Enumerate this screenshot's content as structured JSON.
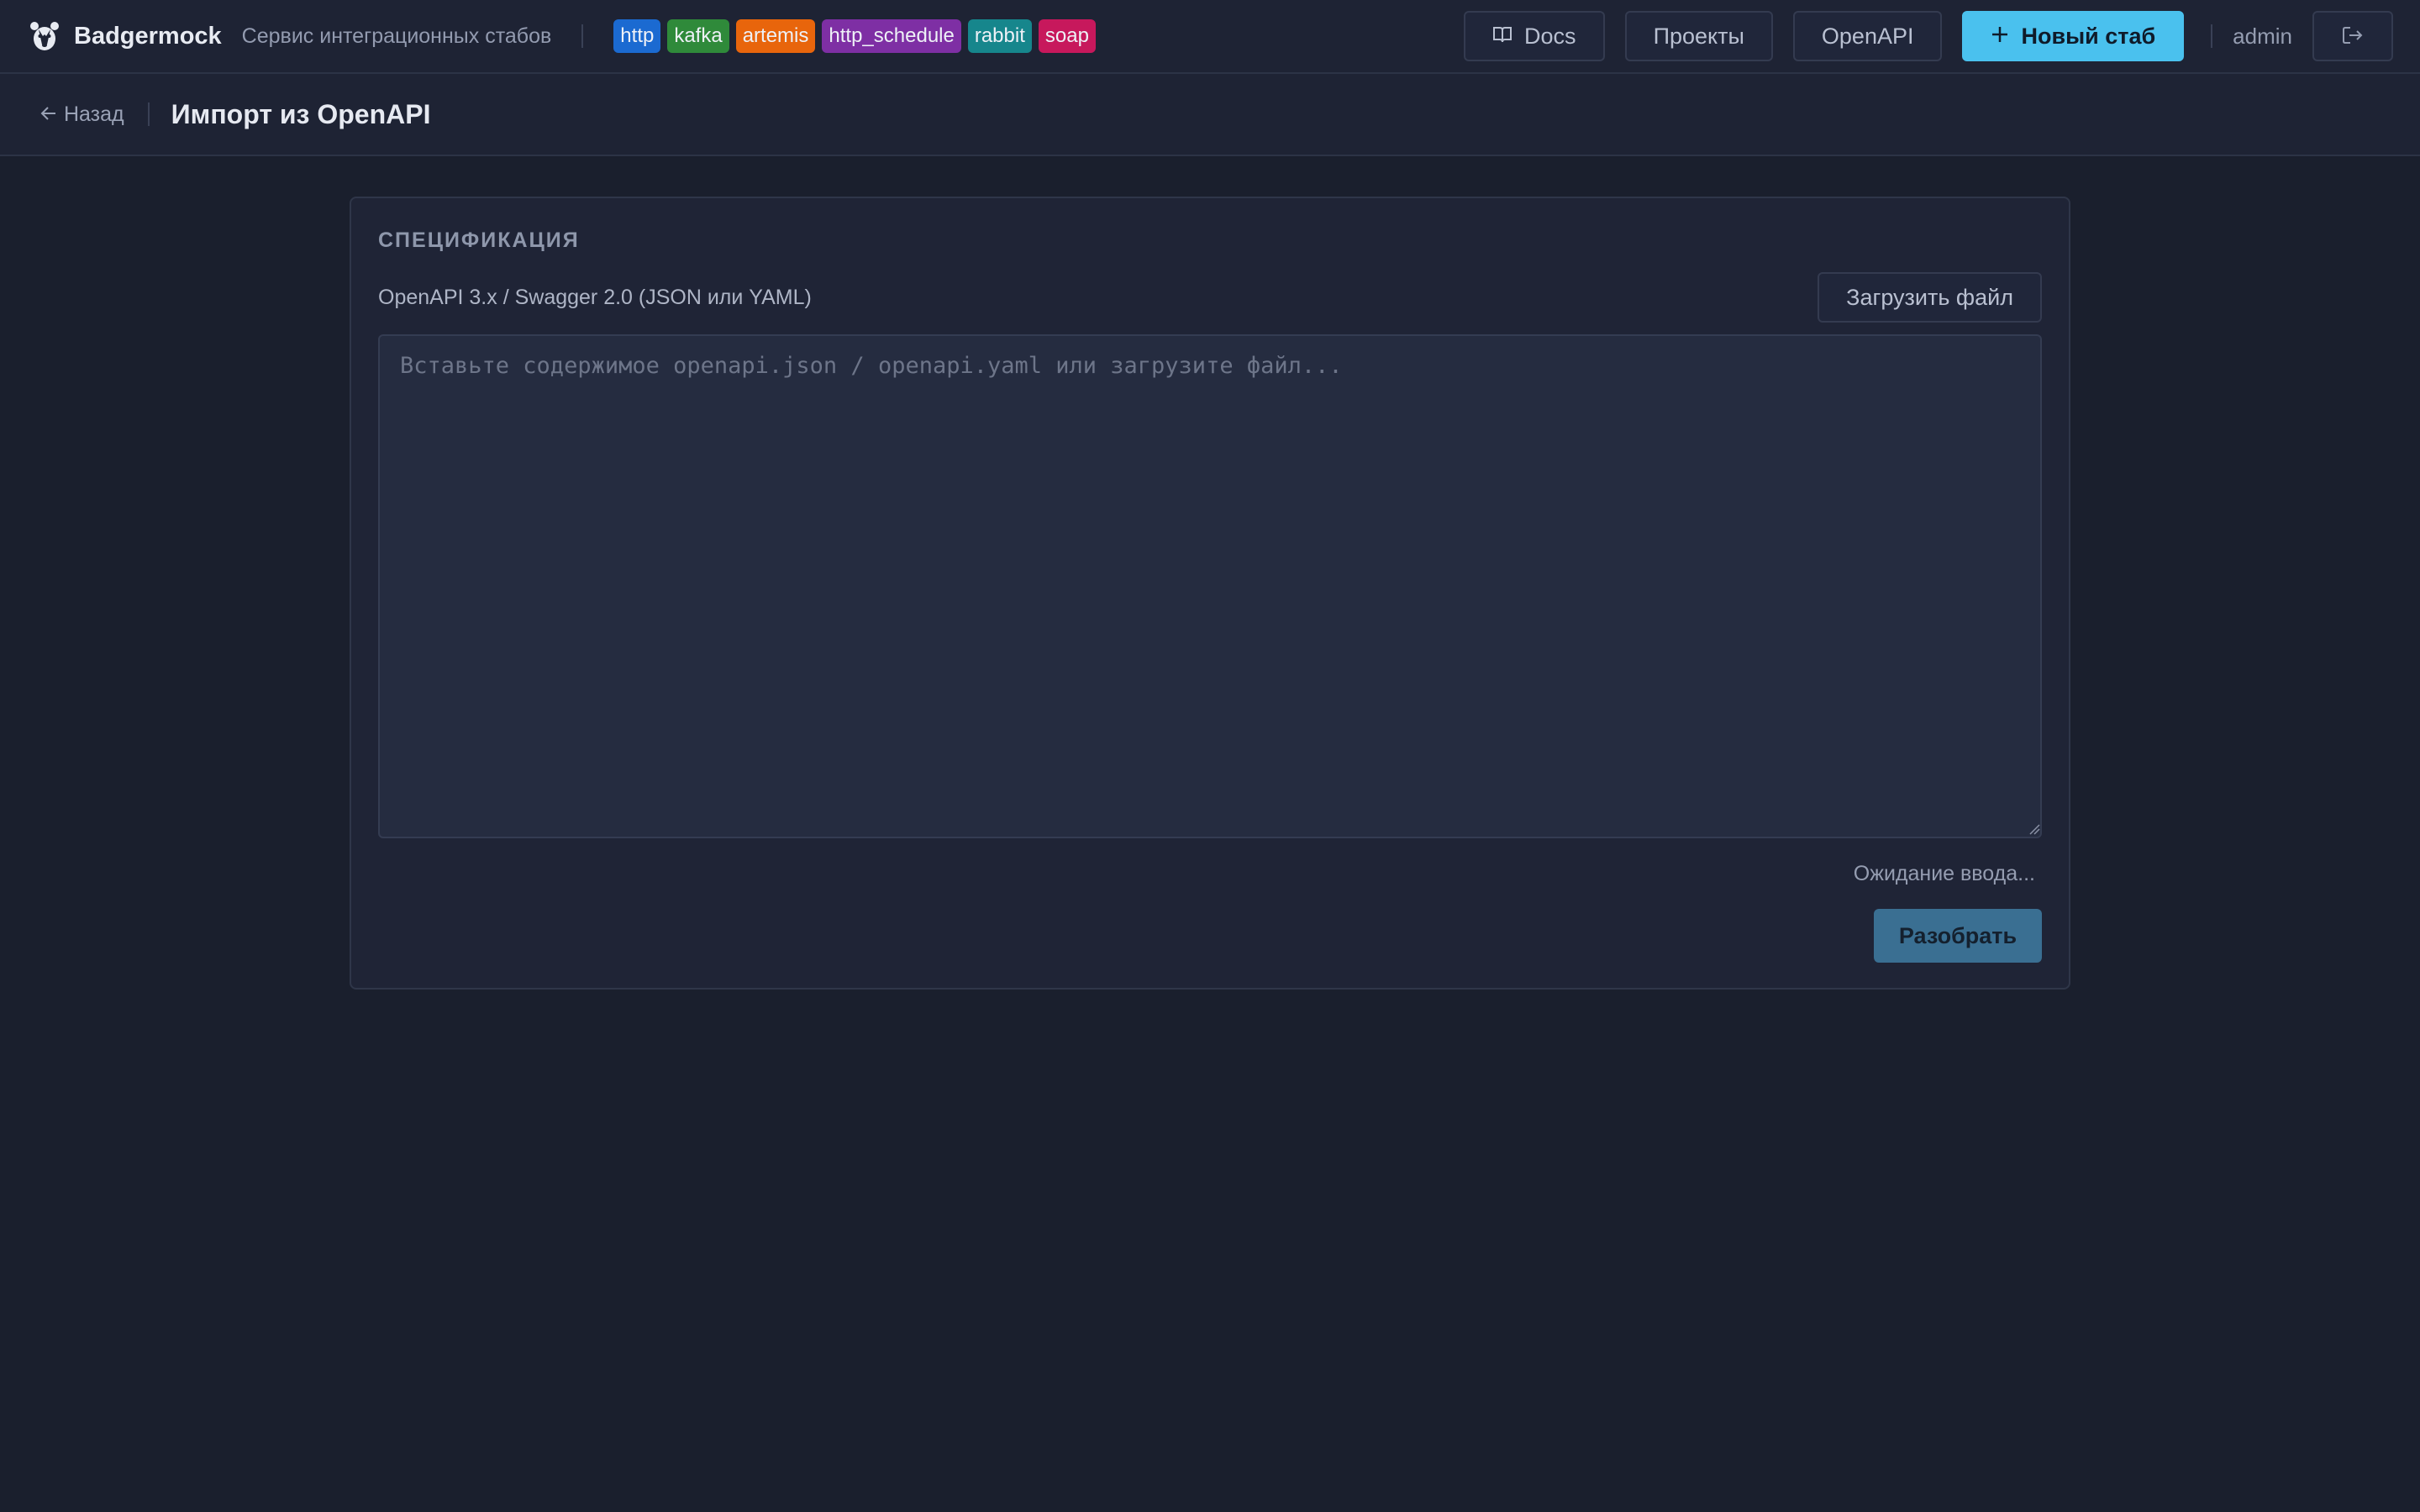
{
  "header": {
    "brand_name": "Badgermock",
    "brand_subtitle": "Сервис интеграционных стабов",
    "protocol_tags": [
      {
        "label": "http",
        "color": "#1b6ad1"
      },
      {
        "label": "kafka",
        "color": "#2f8a3a"
      },
      {
        "label": "artemis",
        "color": "#e8650c"
      },
      {
        "label": "http_schedule",
        "color": "#7e2fa4"
      },
      {
        "label": "rabbit",
        "color": "#16868c"
      },
      {
        "label": "soap",
        "color": "#c7185c"
      }
    ],
    "nav": {
      "docs_label": "Docs",
      "projects_label": "Проекты",
      "openapi_label": "OpenAPI",
      "new_stub_label": "Новый стаб"
    },
    "user_name": "admin",
    "icons": {
      "logo": "badger-icon",
      "docs": "book-icon",
      "new": "plus-icon",
      "logout": "logout-icon"
    }
  },
  "subheader": {
    "back_label": "Назад",
    "page_title": "Импорт из OpenAPI"
  },
  "spec": {
    "section_title": "СПЕЦИФИКАЦИЯ",
    "format_label": "OpenAPI 3.x / Swagger 2.0 (JSON или YAML)",
    "upload_label": "Загрузить файл",
    "input_value": "",
    "input_placeholder": "Вставьте содержимое openapi.json / openapi.yaml или загрузите файл...",
    "status_text": "Ожидание ввода...",
    "parse_label": "Разобрать"
  },
  "colors": {
    "accent": "#4ac1ee",
    "background": "#1a1f2d"
  }
}
